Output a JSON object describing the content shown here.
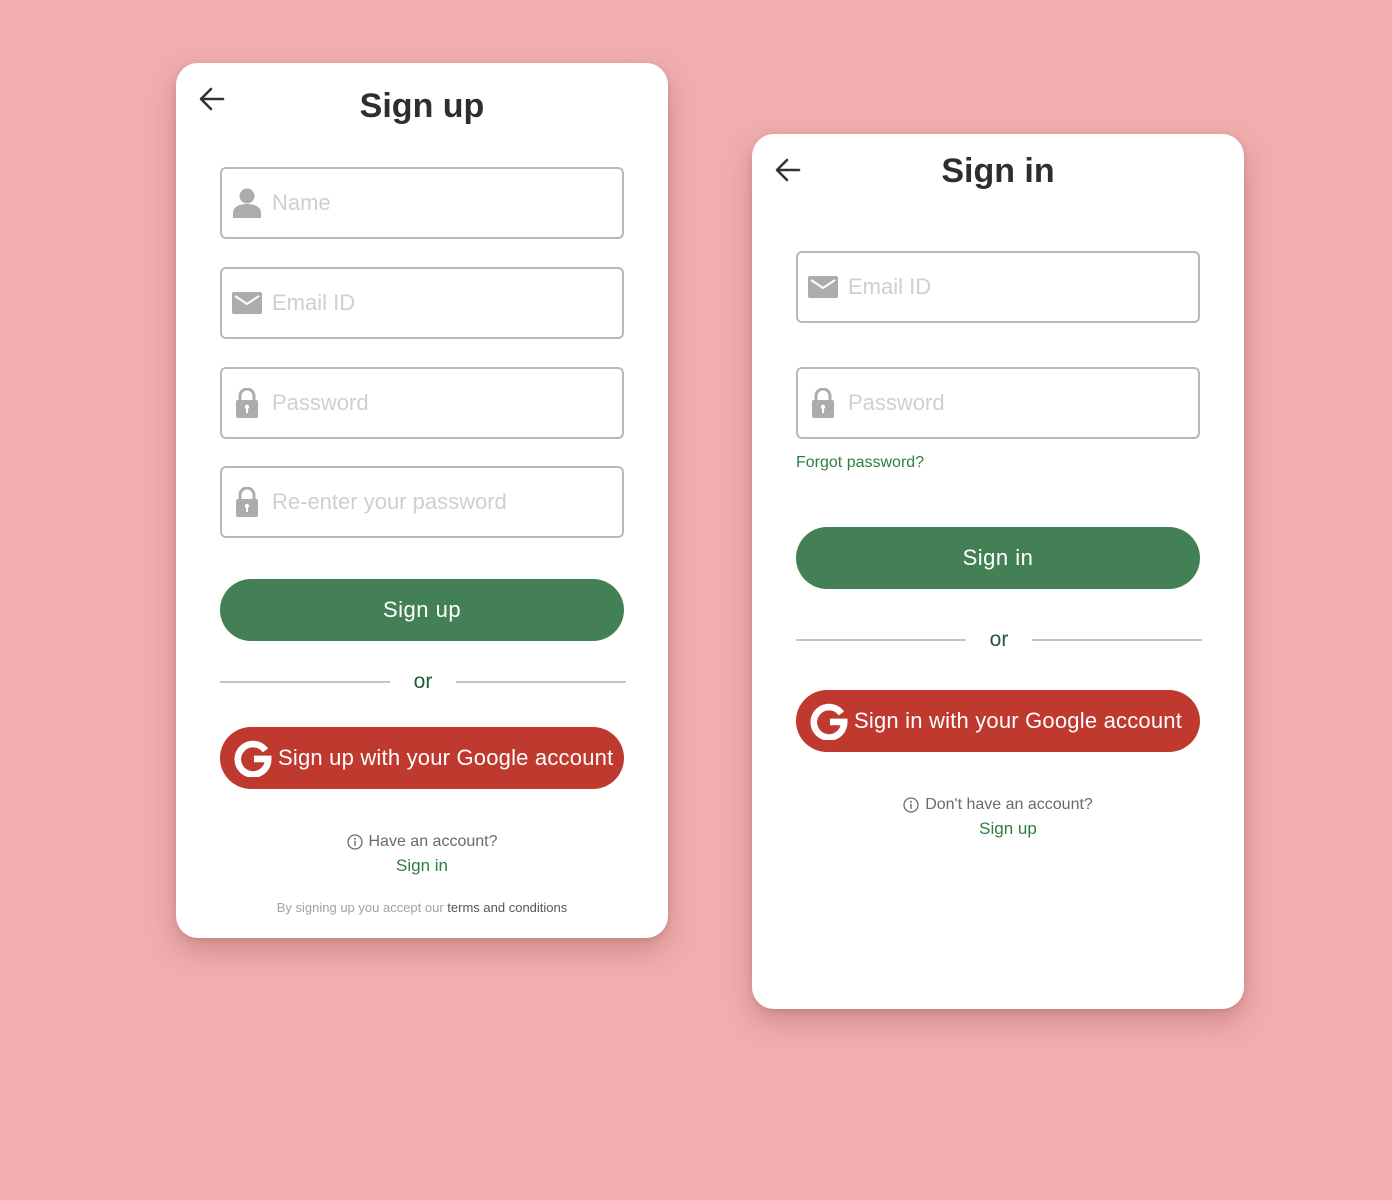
{
  "colors": {
    "background": "#f0aeae",
    "primary_green": "#438055",
    "google_red": "#bf392e",
    "link_green": "#2f7d3f",
    "or_text": "#1e5a3a"
  },
  "signup": {
    "title": "Sign up",
    "back_icon": "arrow-left-icon",
    "fields": [
      {
        "icon": "user-icon",
        "placeholder": "Name",
        "value": ""
      },
      {
        "icon": "mail-icon",
        "placeholder": "Email ID",
        "value": ""
      },
      {
        "icon": "lock-icon",
        "placeholder": "Password",
        "value": ""
      },
      {
        "icon": "lock-icon",
        "placeholder": "Re-enter your password",
        "value": ""
      }
    ],
    "submit_label": "Sign up",
    "or_label": "or",
    "google_label": "Sign up with your Google account",
    "account_prompt": "Have an account?",
    "account_link": "Sign in",
    "terms_prefix": "By signing up you accept our",
    "terms_link": "terms and conditions"
  },
  "signin": {
    "title": "Sign in",
    "back_icon": "arrow-left-icon",
    "fields": [
      {
        "icon": "mail-icon",
        "placeholder": "Email ID",
        "value": ""
      },
      {
        "icon": "lock-icon",
        "placeholder": "Password",
        "value": ""
      }
    ],
    "forgot_label": "Forgot password?",
    "submit_label": "Sign in",
    "or_label": "or",
    "google_label": "Sign in with your Google account",
    "account_prompt": "Don't have an account?",
    "account_link": "Sign up"
  }
}
